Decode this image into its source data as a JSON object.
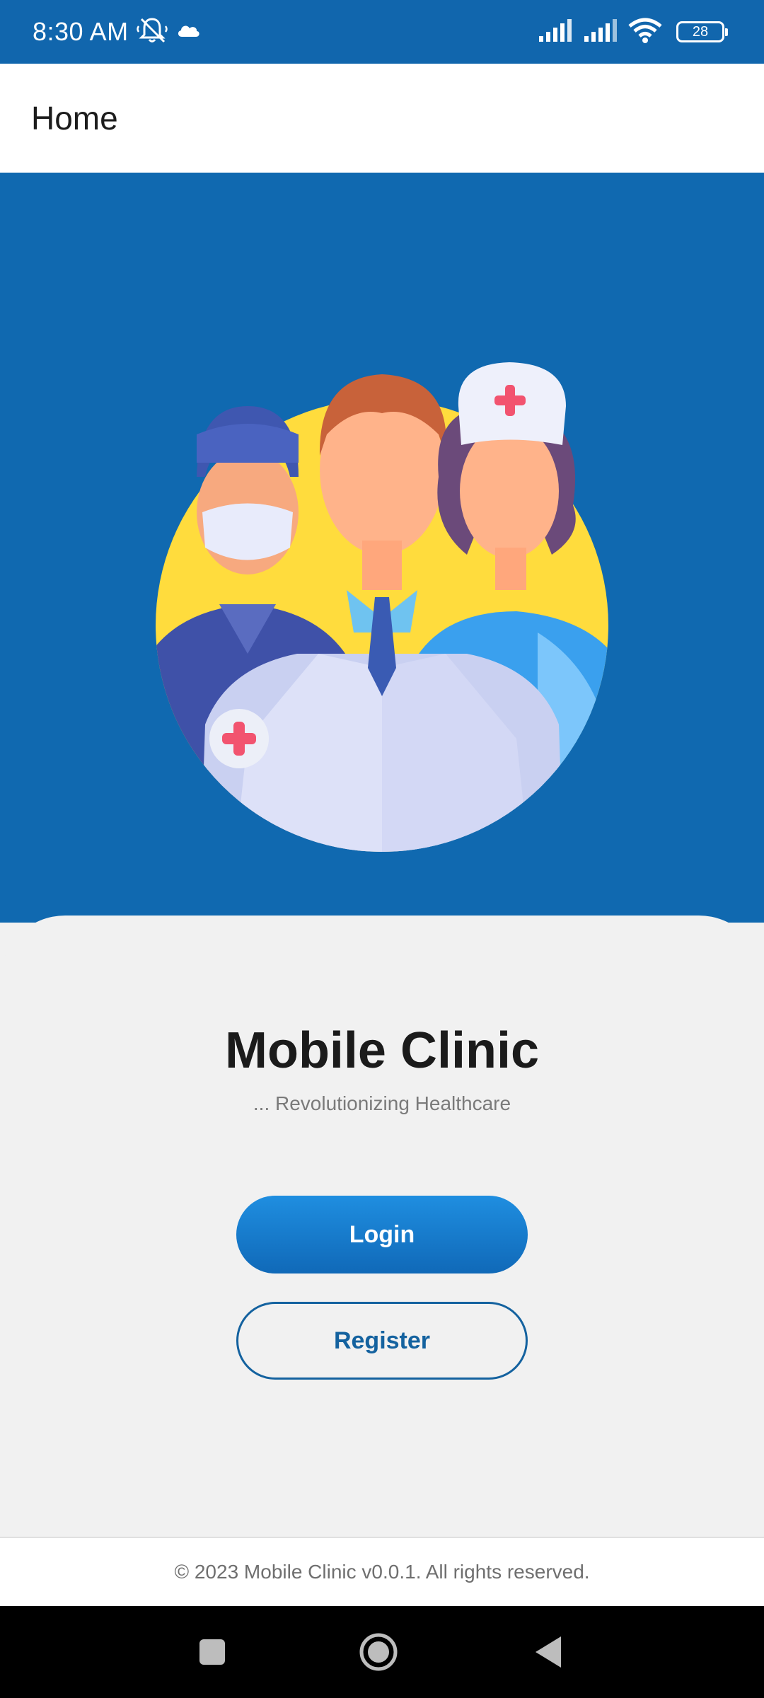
{
  "status_bar": {
    "time": "8:30 AM",
    "battery": "28",
    "icons": [
      "mute-bell-icon",
      "cloud-icon",
      "signal-icon",
      "signal-icon",
      "wifi-icon",
      "battery-icon"
    ]
  },
  "app_bar": {
    "title": "Home"
  },
  "hero": {
    "illustration": "medical-staff-illustration"
  },
  "card": {
    "app_name": "Mobile Clinic",
    "tagline": "... Revolutionizing Healthcare",
    "login_label": "Login",
    "register_label": "Register"
  },
  "footer": {
    "text": "© 2023 Mobile Clinic v0.0.1. All rights reserved."
  },
  "nav_bar": {
    "icons": [
      "recents-icon",
      "home-icon",
      "back-icon"
    ]
  },
  "colors": {
    "primary": "#1069b0",
    "accent_gradient_top": "#1f8ee0",
    "register_outline": "#14629f",
    "card_bg": "#f1f1f1"
  }
}
